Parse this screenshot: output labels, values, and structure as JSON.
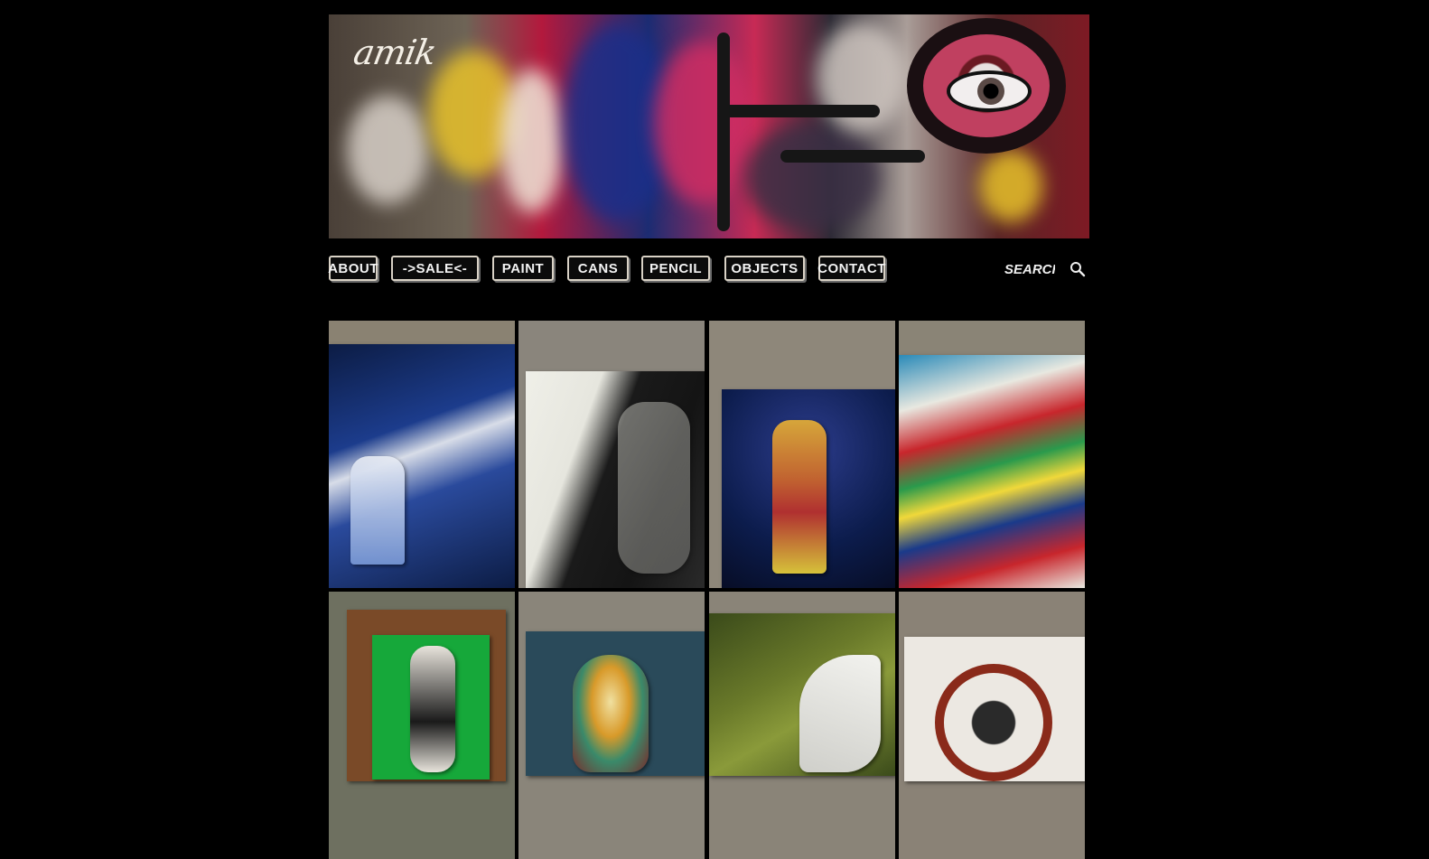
{
  "header": {
    "logo_text": "amik",
    "banner_colors": [
      "#b3193d",
      "#1c2c72",
      "#e8c22a",
      "#c82a55",
      "#ffffff"
    ]
  },
  "nav": {
    "items": [
      {
        "label": "ABOUT"
      },
      {
        "label": "->SALE<-"
      },
      {
        "label": "PAINT"
      },
      {
        "label": "CANS"
      },
      {
        "label": "PENCIL"
      },
      {
        "label": "OBJECTS"
      },
      {
        "label": "CONTACT"
      }
    ],
    "search_placeholder": "SEARCH",
    "search_icon": "magnifier-icon"
  },
  "gallery": {
    "tiles": [
      {
        "name": "painting-girl-blue-dress",
        "colors": [
          "#1c3c8c",
          "#d8dde8",
          "#0c1c44"
        ]
      },
      {
        "name": "painting-woman-hand-face",
        "colors": [
          "#efefe8",
          "#141414",
          "#8a8a86"
        ]
      },
      {
        "name": "painting-fox-robot",
        "colors": [
          "#0c1c4c",
          "#d6a63a",
          "#b03030"
        ]
      },
      {
        "name": "painting-wind-stripes",
        "colors": [
          "#2a8ab8",
          "#c8262c",
          "#2a9a4c"
        ]
      },
      {
        "name": "painting-green-figure",
        "colors": [
          "#16a83a",
          "#7a4a28",
          "#e8e4dc"
        ]
      },
      {
        "name": "painting-mask",
        "colors": [
          "#2a4a5a",
          "#d89a2a",
          "#3a8a6a"
        ]
      },
      {
        "name": "painting-white-wings",
        "colors": [
          "#6a7a2a",
          "#f2f2ee",
          "#3a4a1a"
        ]
      },
      {
        "name": "painting-circle-castle",
        "colors": [
          "#ece8e2",
          "#8a2a1a",
          "#2a2a2a"
        ]
      }
    ]
  }
}
